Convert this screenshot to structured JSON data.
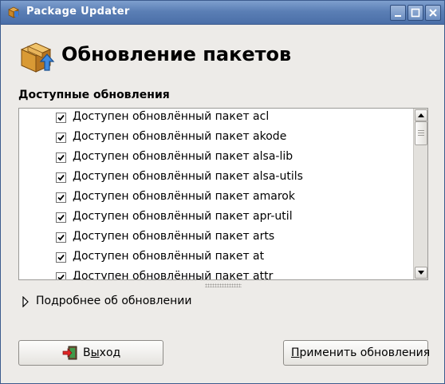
{
  "window": {
    "title": "Package Updater"
  },
  "header": {
    "title": "Обновление пакетов",
    "icon": "package-update-icon"
  },
  "updates": {
    "label": "Доступные обновления",
    "label_mnemonic": "Д",
    "label_rest": "оступные обновления",
    "items": [
      {
        "label": "Доступен обновлённый пакет acl",
        "checked": true
      },
      {
        "label": "Доступен обновлённый пакет akode",
        "checked": true
      },
      {
        "label": "Доступен обновлённый пакет alsa-lib",
        "checked": true
      },
      {
        "label": "Доступен обновлённый пакет alsa-utils",
        "checked": true
      },
      {
        "label": "Доступен обновлённый пакет amarok",
        "checked": true
      },
      {
        "label": "Доступен обновлённый пакет apr-util",
        "checked": true
      },
      {
        "label": "Доступен обновлённый пакет arts",
        "checked": true
      },
      {
        "label": "Доступен обновлённый пакет at",
        "checked": true
      },
      {
        "label": "Доступен обновлённый пакет attr",
        "checked": true
      }
    ]
  },
  "details": {
    "label": "Подробнее об обновлении",
    "expanded": false
  },
  "buttons": {
    "close": {
      "label_pre": "В",
      "mnemonic": "ы",
      "label_post": "ход",
      "label": "Выход",
      "icon": "exit-icon"
    },
    "apply": {
      "mnemonic": "П",
      "label_post": "рименить обновления",
      "label": "Применить обновления"
    }
  },
  "colors": {
    "titlebar": "#5b7fb5",
    "window_bg": "#edebe8",
    "list_bg": "#ffffff"
  }
}
